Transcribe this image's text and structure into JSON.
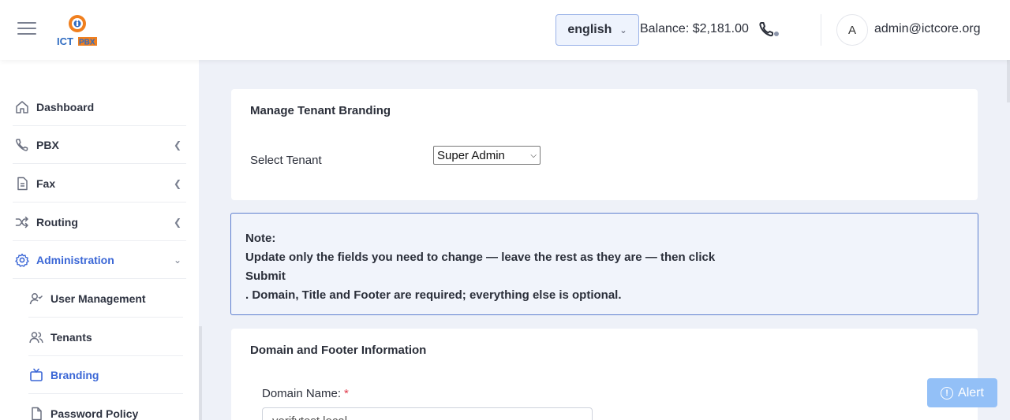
{
  "header": {
    "logo_text": "ICTPBX",
    "language": "english",
    "balance": "Balance: $2,181.00",
    "avatar_initial": "A",
    "user_email": "admin@ictcore.org"
  },
  "sidebar": {
    "items": [
      {
        "label": "Dashboard",
        "icon": "home-icon"
      },
      {
        "label": "PBX",
        "icon": "phone-icon"
      },
      {
        "label": "Fax",
        "icon": "document-icon"
      },
      {
        "label": "Routing",
        "icon": "shuffle-icon"
      },
      {
        "label": "Administration",
        "icon": "gear-icon"
      }
    ],
    "sub_items": [
      {
        "label": "User Management",
        "icon": "user-check-icon"
      },
      {
        "label": "Tenants",
        "icon": "users-icon"
      },
      {
        "label": "Branding",
        "icon": "tv-icon"
      },
      {
        "label": "Password Policy",
        "icon": "file-icon"
      }
    ]
  },
  "branding": {
    "title": "Manage Tenant Branding",
    "select_label": "Select Tenant",
    "selected_tenant": "Super Admin"
  },
  "note": {
    "heading": "Note:",
    "line1": "Update only the fields you need to change — leave the rest as they are — then click",
    "line2": "Submit",
    "line3": ". Domain, Title and Footer are required; everything else is optional."
  },
  "domain_section": {
    "title": "Domain and Footer Information",
    "domain_label": "Domain Name:",
    "required_mark": "*",
    "domain_value": "verifytest.local"
  },
  "alert": {
    "label": "Alert",
    "icon_glyph": "!"
  },
  "colors": {
    "accent": "#3b67d6",
    "alert_bg": "#93c0f7",
    "required": "#e0394a"
  }
}
